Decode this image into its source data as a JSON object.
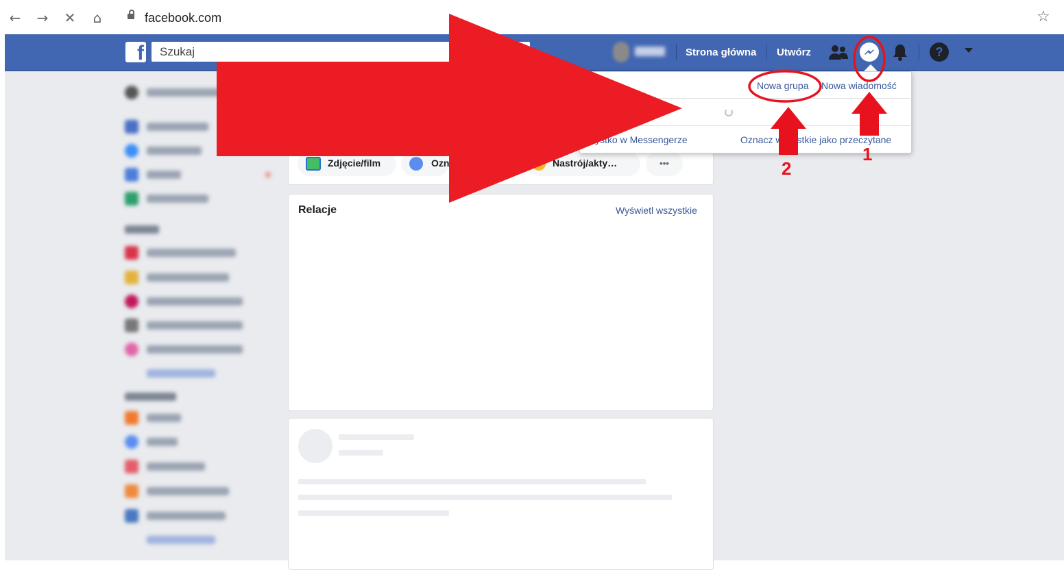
{
  "browser": {
    "url": "facebook.com",
    "back_icon": "←",
    "forward_icon": "→",
    "stop_icon": "✕",
    "home_icon": "⌂",
    "bookmark_icon": "☆"
  },
  "header": {
    "logo": "f",
    "search_placeholder": "Szukaj",
    "home_link": "Strona główna",
    "create_link": "Utwórz",
    "help_icon": "?"
  },
  "composer": {
    "photo_label": "Zdjęcie/film",
    "tag_label": "Ozn",
    "feeling_label": "Nastrój/akty…",
    "more_label": "•••"
  },
  "stories": {
    "title": "Relacje",
    "view_all": "Wyświetl wszystkie"
  },
  "messenger_dropdown": {
    "new_group": "Nowa grupa",
    "new_message": "Nowa wiadomość",
    "see_all": "Zobacz wszystko w Messengerze",
    "see_all_visible": "ystko w Messengerze",
    "mark_all_read": "Oznacz wszystkie jako przeczytane"
  },
  "annotations": {
    "step1": "1",
    "step2": "2",
    "color": "#e8121e"
  },
  "colors": {
    "fb_blue": "#4267b2",
    "link_blue": "#385898",
    "page_bg": "#e9ebee"
  }
}
